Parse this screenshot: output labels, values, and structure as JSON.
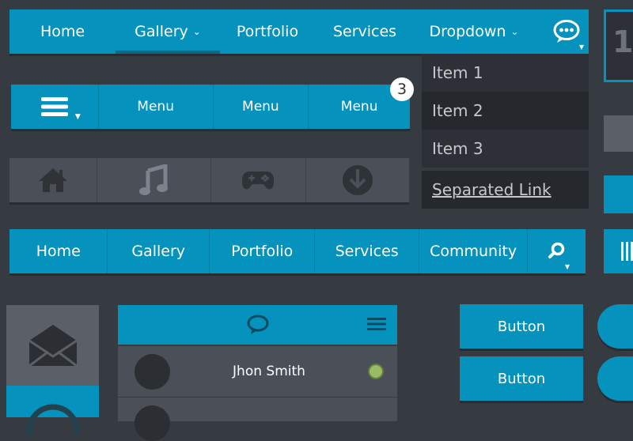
{
  "topnav": {
    "items": [
      {
        "label": "Home",
        "has_chevron": false
      },
      {
        "label": "Gallery",
        "has_chevron": true,
        "chevron": "⌄"
      },
      {
        "label": "Portfolio",
        "has_chevron": false
      },
      {
        "label": "Services",
        "has_chevron": false
      },
      {
        "label": "Dropdown",
        "has_chevron": true,
        "chevron": "⌄"
      }
    ],
    "chat_icon": "speech-bubble-icon",
    "caret": "▼"
  },
  "dropdown": {
    "items": [
      "Item 1",
      "Item 2",
      "Item 3"
    ],
    "separated_link": "Separated Link"
  },
  "edge": {
    "number": "1"
  },
  "menunav": {
    "hamburger_icon": "hamburger-icon",
    "caret": "▼",
    "items": [
      "Menu",
      "Menu",
      "Menu"
    ],
    "badge": "3"
  },
  "iconnav": {
    "icons": [
      "home-icon",
      "music-icon",
      "gamepad-icon",
      "download-icon"
    ]
  },
  "textnav": {
    "items": [
      "Home",
      "Gallery",
      "Portfolio",
      "Services",
      "Community"
    ],
    "search_icon": "search-icon",
    "caret": "▼"
  },
  "contact": {
    "header_icon": "chat-icon",
    "menu_icon": "menu-lines-icon",
    "rows": [
      {
        "name": "Jhon Smith",
        "status": "online"
      }
    ]
  },
  "buttons": [
    "Button",
    "Button"
  ],
  "colors": {
    "accent": "#0592bd",
    "background": "#363a41",
    "dropdown_bg": "#2d3036",
    "online": "#99bb66"
  }
}
